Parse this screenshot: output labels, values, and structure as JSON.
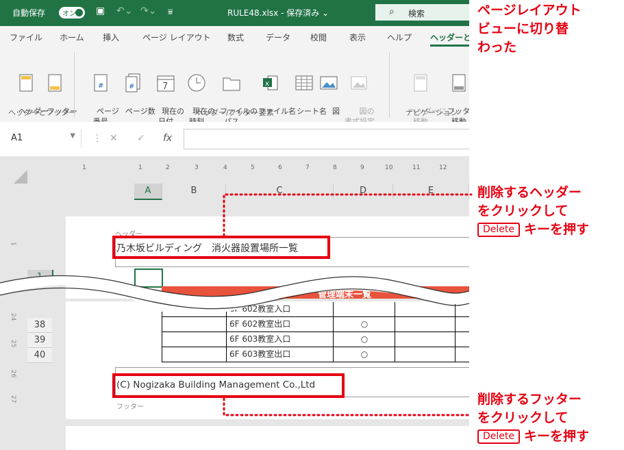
{
  "titlebar": {
    "autosave_label": "自動保存",
    "autosave_state": "オン",
    "filename": "RULE48.xlsx - 保存済み ⌄",
    "search_placeholder": "検索"
  },
  "tabs": [
    "ファイル",
    "ホーム",
    "挿入",
    "ページ レイアウト",
    "数式",
    "データ",
    "校閲",
    "表示",
    "ヘルプ",
    "ヘッダーと"
  ],
  "ribbon": {
    "group1": {
      "label": "ヘッダーとフッター",
      "buttons": [
        "ヘッダー\n⌄",
        "フッター\n⌄"
      ]
    },
    "group2": {
      "label": "ヘッダー/フッター要素",
      "buttons": [
        "ページ\n番号",
        "ページ数",
        "現在の\n日付",
        "現在の\n時刻",
        "ファイルの\nパス",
        "ファイル名",
        "シート名",
        "図",
        "図の\n書式設定"
      ]
    },
    "group3": {
      "label": "ナビゲーション",
      "buttons": [
        "ヘッダーに\n移動",
        "フッターに\n移動"
      ]
    }
  },
  "formula_bar": {
    "cell_ref": "A1",
    "fx": "fx"
  },
  "ruler_ticks": [
    "1",
    "1",
    "2",
    "3",
    "4",
    "5",
    "6",
    "7",
    "8",
    "9",
    "10",
    "11",
    "12"
  ],
  "columns": [
    "A",
    "B",
    "C",
    "D",
    "E"
  ],
  "vertical_ruler": [
    "1",
    "24",
    "25",
    "26",
    "27"
  ],
  "header_label": "ヘッダー",
  "header_text": "乃木坂ビルディング　消火器設置場所一覧",
  "footer_label": "フッター",
  "footer_text": "(C) Nogizaka Building Management Co.,Ltd",
  "row_numbers": [
    "1",
    "38",
    "39",
    "40"
  ],
  "table_title_partial": "管理端末一覧",
  "table_rows": [
    {
      "location": "6F 602教室入口",
      "mark": ""
    },
    {
      "location": "6F 602教室出口",
      "mark": "○"
    },
    {
      "location": "6F 603教室入口",
      "mark": "○"
    },
    {
      "location": "6F 603教室出口",
      "mark": "○"
    }
  ],
  "annotations": {
    "top": [
      "ページレイアウト",
      "ビューに切り替",
      "わった"
    ],
    "header": [
      "削除するヘッダー",
      "をクリックして",
      "キーを押す"
    ],
    "footer": [
      "削除するフッター",
      "をクリックして",
      "キーを押す"
    ],
    "key": "Delete"
  },
  "colors": {
    "excel_green": "#217346",
    "accent_red": "#e50012",
    "table_header": "#e8533c"
  }
}
